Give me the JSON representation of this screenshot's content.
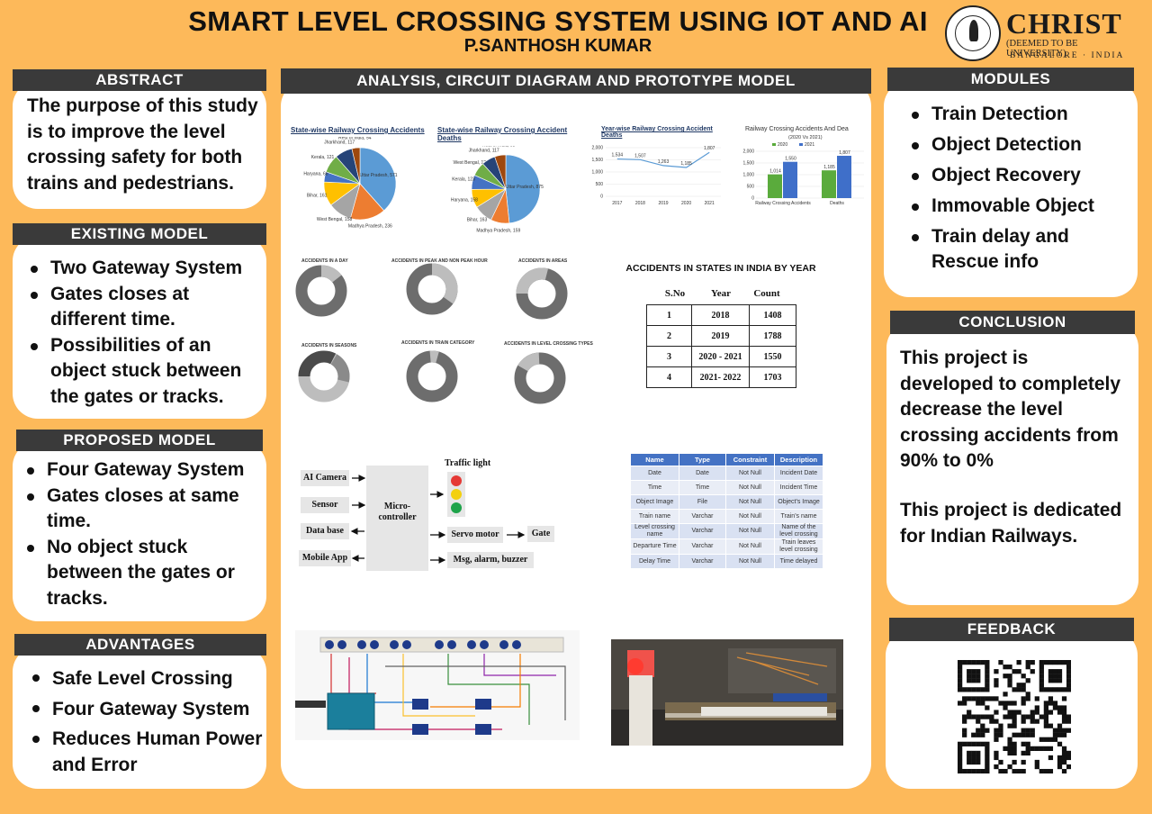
{
  "header": {
    "title": "SMART LEVEL CROSSING SYSTEM USING IOT AND AI",
    "author": "P.SANTHOSH KUMAR",
    "logo": {
      "name": "CHRIST",
      "sub": "(DEEMED TO BE UNIVERSITY)",
      "city": "BANGALORE · INDIA"
    }
  },
  "abstract": {
    "heading": "ABSTRACT",
    "text": "The purpose of this study is to improve the level crossing safety for both trains and pedestrians."
  },
  "existing": {
    "heading": "EXISTING MODEL",
    "items": [
      "Two Gateway System",
      "Gates closes at different time.",
      "Possibilities of an object stuck between the gates or tracks."
    ]
  },
  "proposed": {
    "heading": "PROPOSED MODEL",
    "items": [
      "Four Gateway System",
      "Gates closes at same time.",
      "No object stuck between the gates or tracks."
    ]
  },
  "advantages": {
    "heading": "ADVANTAGES",
    "items": [
      "Safe Level Crossing",
      "Four Gateway System",
      "Reduces Human Power and Error"
    ]
  },
  "center": {
    "heading": "ANALYSIS,  CIRCUIT DIAGRAM  AND  PROTOTYPE MODEL",
    "chart_titles": {
      "pie1": "State-wise Railway Crossing Accidents",
      "pie2": "State-wise Railway Crossing Accident Deaths",
      "line": "Year-wise Railway Crossing Accident Deaths",
      "bar": "Railway Crossing Accidents And Dea",
      "bar_sub": "(2020 Vs 2021)"
    },
    "donut_titles": [
      "ACCIDENTS IN A DAY",
      "ACCIDENTS IN PEAK AND NON PEAK HOUR",
      "ACCIDENTS IN AREAS",
      "ACCIDENTS IN SEASONS",
      "ACCIDENTS IN TRAIN CATEGORY",
      "ACCIDENTS IN LEVEL CROSSING TYPES"
    ],
    "table_title": "ACCIDENTS IN STATES IN INDIA BY YEAR",
    "table_headers": [
      "S.No",
      "Year",
      "Count"
    ],
    "table_rows": [
      [
        "1",
        "2018",
        "1408"
      ],
      [
        "2",
        "2019",
        "1788"
      ],
      [
        "3",
        "2020 - 2021",
        "1550"
      ],
      [
        "4",
        "2021- 2022",
        "1703"
      ]
    ],
    "block": {
      "inputs": [
        "AI Camera",
        "Sensor",
        "Data base",
        "Mobile App"
      ],
      "controller": "Micro-controller",
      "traffic": "Traffic light",
      "servo": "Servo motor",
      "gate": "Gate",
      "alarm": "Msg, alarm, buzzer"
    },
    "schema_headers": [
      "Name",
      "Type",
      "Constraint",
      "Description"
    ],
    "schema_rows": [
      [
        "Date",
        "Date",
        "Not Null",
        "Incident Date"
      ],
      [
        "Time",
        "Time",
        "Not Null",
        "Incident Time"
      ],
      [
        "Object Image",
        "File",
        "Not Null",
        "Object's Image"
      ],
      [
        "Train name",
        "Varchar",
        "Not Null",
        "Train's name"
      ],
      [
        "Level crossing name",
        "Varchar",
        "Not Null",
        "Name of the level crossing"
      ],
      [
        "Departure Time",
        "Varchar",
        "Not Null",
        "Train leaves level crossing"
      ],
      [
        "Delay Time",
        "Varchar",
        "Not Null",
        "Time delayed"
      ]
    ]
  },
  "chart_data": [
    {
      "type": "pie",
      "title": "State-wise Railway Crossing Accidents",
      "categories": [
        "Uttar Pradesh",
        "Madhya Pradesh",
        "West Bengal",
        "Bihar",
        "Haryana",
        "Kerala",
        "Jharkhand",
        "Rest of India"
      ],
      "values": [
        571,
        236,
        158,
        161,
        68,
        121,
        117,
        54
      ]
    },
    {
      "type": "pie",
      "title": "State-wise Railway Crossing Accident Deaths",
      "categories": [
        "Uttar Pradesh",
        "Madhya Pradesh",
        "Bihar",
        "Haryana",
        "Kerala",
        "West Bengal",
        "Jharkhand",
        "Rest of India"
      ],
      "values": [
        875,
        159,
        163,
        158,
        123,
        120,
        117,
        95
      ]
    },
    {
      "type": "line",
      "title": "Year-wise Railway Crossing Accident Deaths",
      "x": [
        "2017",
        "2018",
        "2019",
        "2020",
        "2021"
      ],
      "values": [
        1534,
        1507,
        1263,
        1185,
        1807
      ],
      "ylim": [
        0,
        2000
      ],
      "yticks": [
        "2,000",
        "1,500",
        "1,000",
        "500",
        "0"
      ]
    },
    {
      "type": "bar",
      "title": "Railway Crossing Accidents And Dea",
      "subtitle": "(2020 Vs 2021)",
      "categories": [
        "Railway Crossing Accidents",
        "Deaths"
      ],
      "series": [
        {
          "name": "2020",
          "values": [
            1014,
            1185
          ]
        },
        {
          "name": "2021",
          "values": [
            1550,
            1807
          ]
        }
      ],
      "ylim": [
        0,
        2000
      ],
      "colors": [
        "#5aab3c",
        "#3f6fc9"
      ]
    }
  ],
  "modules": {
    "heading": "MODULES",
    "items": [
      "Train Detection",
      "Object Detection",
      "Object Recovery",
      "Immovable Object",
      "Train delay and Rescue info"
    ]
  },
  "conclusion": {
    "heading": "CONCLUSION",
    "text1": "This project is developed to completely decrease the level crossing accidents from 90% to 0%",
    "text2": "This project is dedicated for Indian Railways."
  },
  "feedback": {
    "heading": "FEEDBACK"
  }
}
